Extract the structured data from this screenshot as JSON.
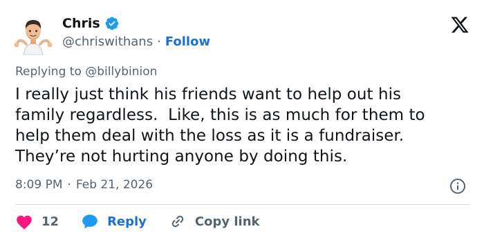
{
  "author": {
    "name": "Chris",
    "handle": "@chriswithans",
    "separator": "·",
    "follow_label": "Follow"
  },
  "reply_context": {
    "prefix": "Replying to",
    "mention": "@billybinion"
  },
  "tweet": {
    "lines": [
      "I really just think his friends want to help out his",
      "family regardless.  Like, this is as much for them to",
      "help them deal with the loss as it is a fundraiser.",
      "They’re not hurting anyone by doing this."
    ],
    "time": "8:09 PM",
    "date": "Feb 21, 2026",
    "separator": "·"
  },
  "actions": {
    "like_count": "12",
    "reply_label": "Reply",
    "copy_label": "Copy link"
  },
  "colors": {
    "verified": "#1d9bf0",
    "follow": "#1d6fd8",
    "heart": "#f91880",
    "reply_bubble": "#1d9bf0",
    "muted": "#536471",
    "divider": "#cfd9de"
  },
  "icons": {
    "avatar": "memoji-avatar",
    "verified": "verified-badge-icon",
    "logo": "x-logo-icon",
    "info": "info-icon",
    "like": "heart-icon",
    "reply": "speech-bubble-icon",
    "copy": "link-icon"
  }
}
